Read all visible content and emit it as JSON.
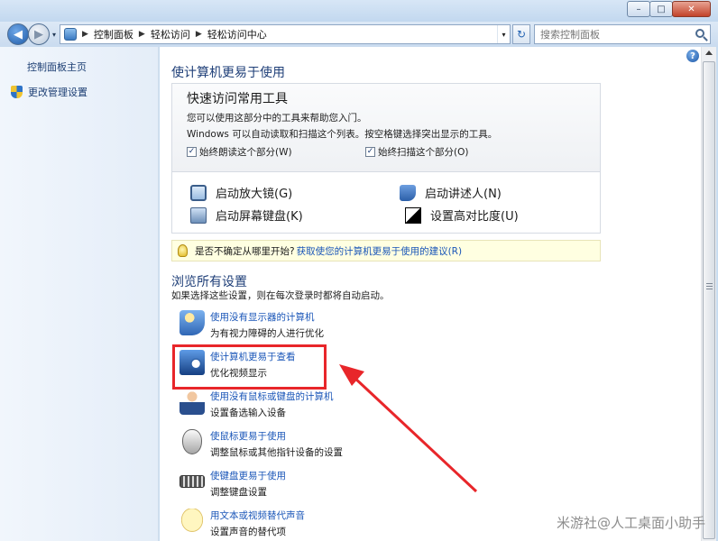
{
  "window": {
    "minimize": "–",
    "maximize": "□",
    "close": "✕"
  },
  "nav": {
    "back": "◀",
    "forward": "▶",
    "dropdown": "▾",
    "breadcrumbs": [
      "控制面板",
      "轻松访问",
      "轻松访问中心"
    ],
    "refresh": "↻",
    "search_placeholder": "搜索控制面板"
  },
  "sidebar": {
    "home": "控制面板主页",
    "admin": "更改管理设置"
  },
  "main": {
    "help": "?",
    "title": "使计算机更易于使用",
    "quick": {
      "title": "快速访问常用工具",
      "desc1": "您可以使用这部分中的工具来帮助您入门。",
      "desc2": "Windows 可以自动读取和扫描这个列表。按空格键选择突出显示的工具。",
      "check_read": "始终朗读这个部分(W)",
      "check_scan": "始终扫描这个部分(O)",
      "check_mark": "✓",
      "tools": {
        "magnifier": "启动放大镜(G)",
        "narrator": "启动讲述人(N)",
        "osk": "启动屏幕键盘(K)",
        "contrast": "设置高对比度(U)"
      }
    },
    "tip": {
      "prefix": "是否不确定从哪里开始?",
      "link": "获取使您的计算机更易于使用的建议(R)"
    },
    "browse": {
      "title": "浏览所有设置",
      "desc": "如果选择这些设置，则在每次登录时都将自动启动。",
      "items": [
        {
          "link": "使用没有显示器的计算机",
          "desc": "为有视力障碍的人进行优化"
        },
        {
          "link": "使计算机更易于查看",
          "desc": "优化视频显示"
        },
        {
          "link": "使用没有鼠标或键盘的计算机",
          "desc": "设置备选输入设备"
        },
        {
          "link": "使鼠标更易于使用",
          "desc": "调整鼠标或其他指针设备的设置"
        },
        {
          "link": "使键盘更易于使用",
          "desc": "调整键盘设置"
        },
        {
          "link": "用文本或视频替代声音",
          "desc": "设置声音的替代项"
        }
      ]
    }
  },
  "watermark": "米游社@人工桌面小助手",
  "colors": {
    "link": "#1a56b8",
    "highlight": "#e8262a",
    "heading": "#1f3f78"
  }
}
